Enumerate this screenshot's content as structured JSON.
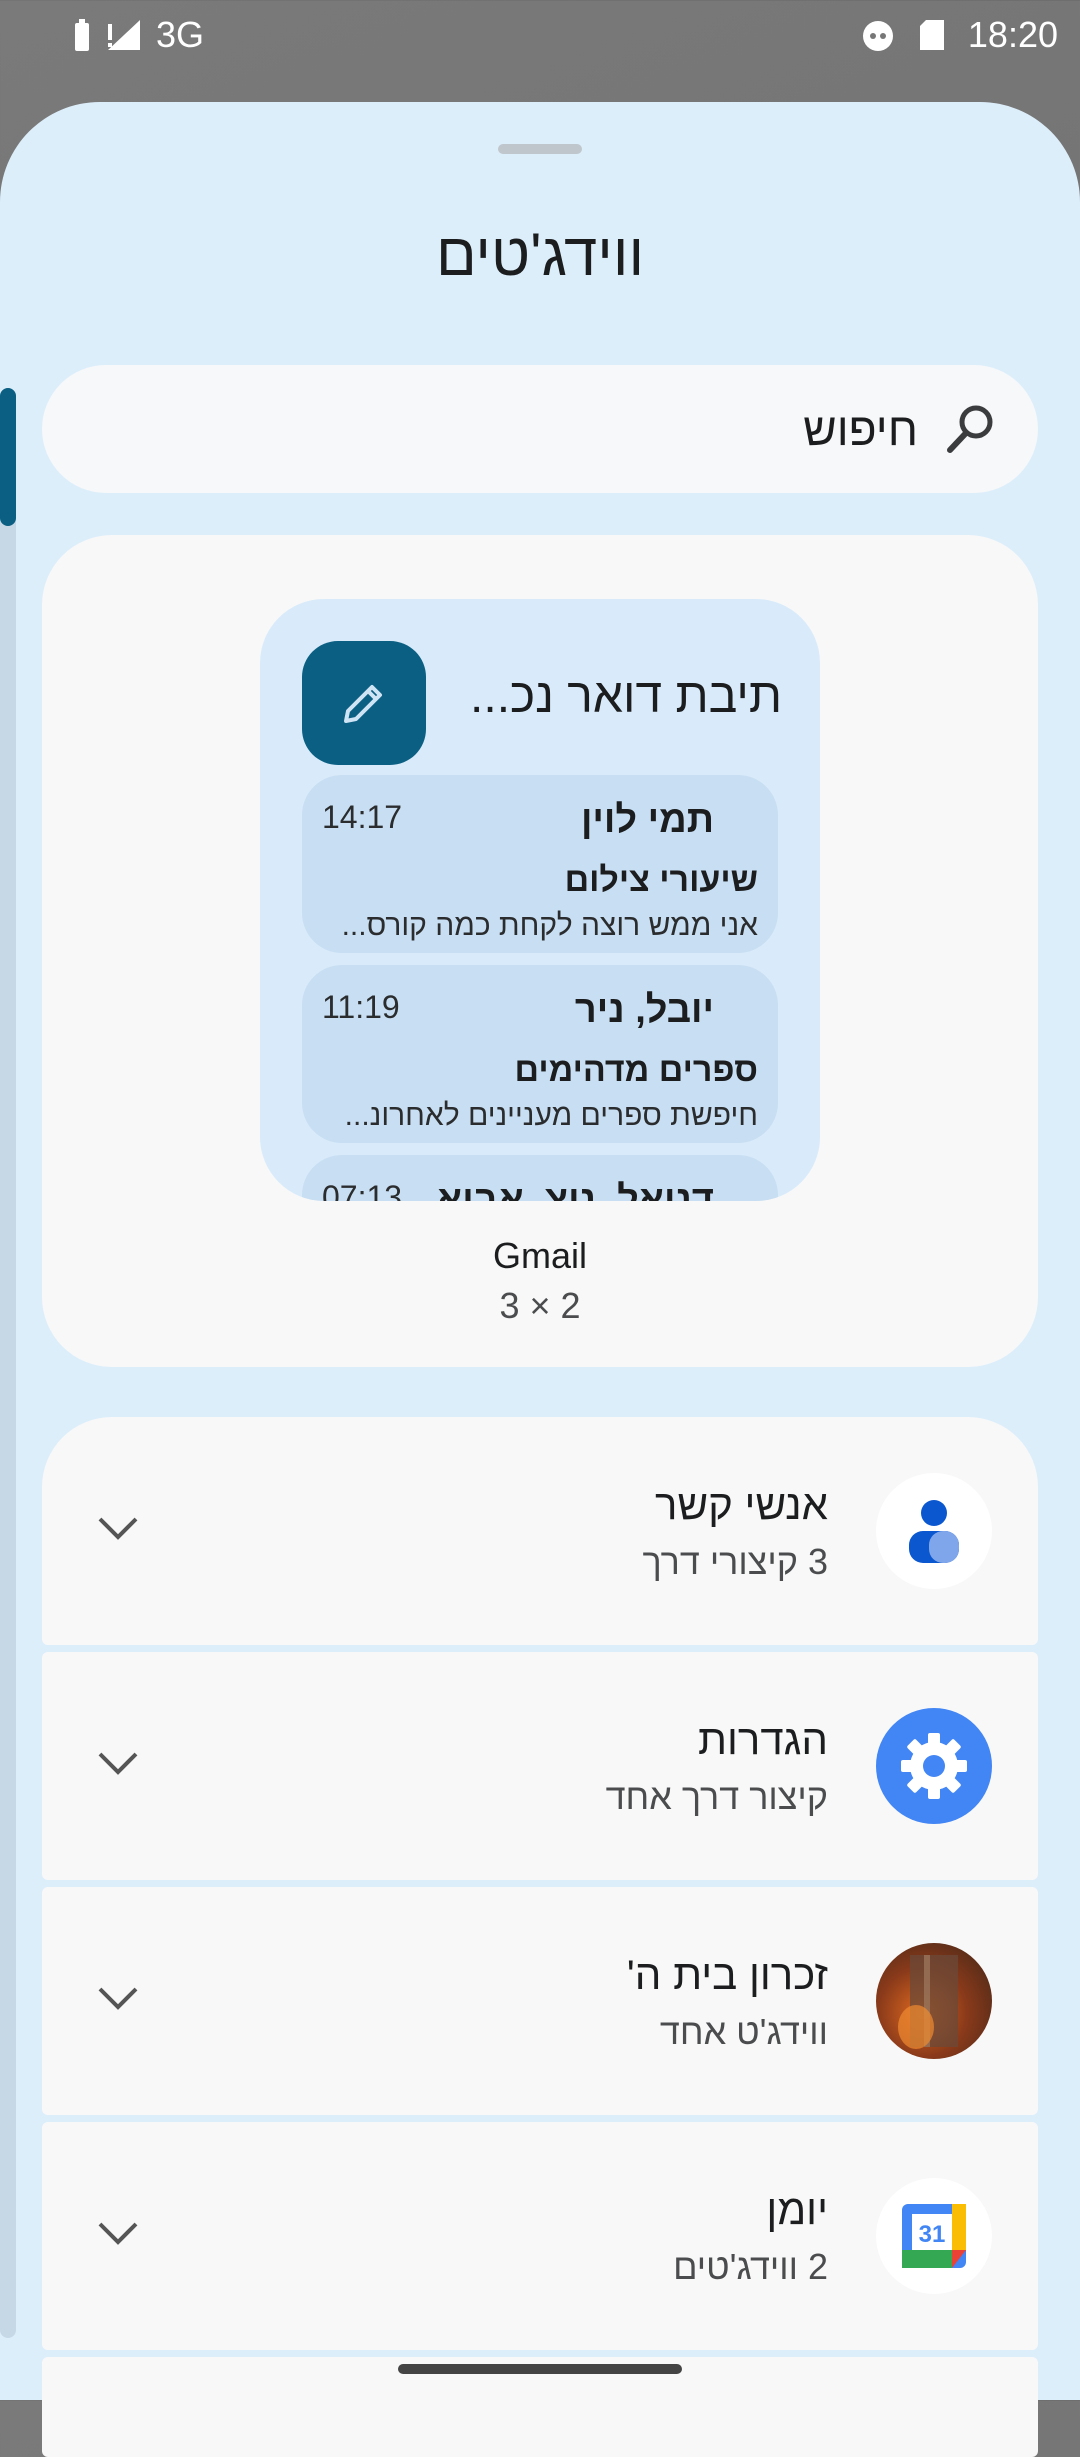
{
  "status_bar": {
    "network": "3G",
    "time": "18:20"
  },
  "sheet": {
    "title": "ווידג'טים"
  },
  "search": {
    "placeholder": "חיפוש"
  },
  "featured": {
    "widget_title": "תיבת דואר נכ...",
    "emails": [
      {
        "sender": "תמי לוין",
        "time": "14:17",
        "subject": "שיעורי צילום",
        "snippet": "אני ממש רוצה לקחת כמה קורס..."
      },
      {
        "sender": "יובל, ניר",
        "time": "11:19",
        "subject": "ספרים מדהימים",
        "snippet": "חיפשת ספרים מעניינים לאחרונ..."
      },
      {
        "sender": "דניאל, ניצ, אביא",
        "time": "07:13",
        "subject": "",
        "snippet": ""
      }
    ],
    "app_name": "Gmail",
    "size": "3 × 2"
  },
  "apps": [
    {
      "name": "אנשי קשר",
      "subtitle": "3 קיצורי דרך",
      "icon": "contacts-icon"
    },
    {
      "name": "הגדרות",
      "subtitle": "קיצור דרך אחד",
      "icon": "settings-gear-icon"
    },
    {
      "name": "זכרון בית ה'",
      "subtitle": "ווידג'ט אחד",
      "icon": "memorial-app-icon"
    },
    {
      "name": "יומן",
      "subtitle": "2 ווידג'טים",
      "icon": "calendar-icon",
      "icon_text": "31"
    }
  ]
}
